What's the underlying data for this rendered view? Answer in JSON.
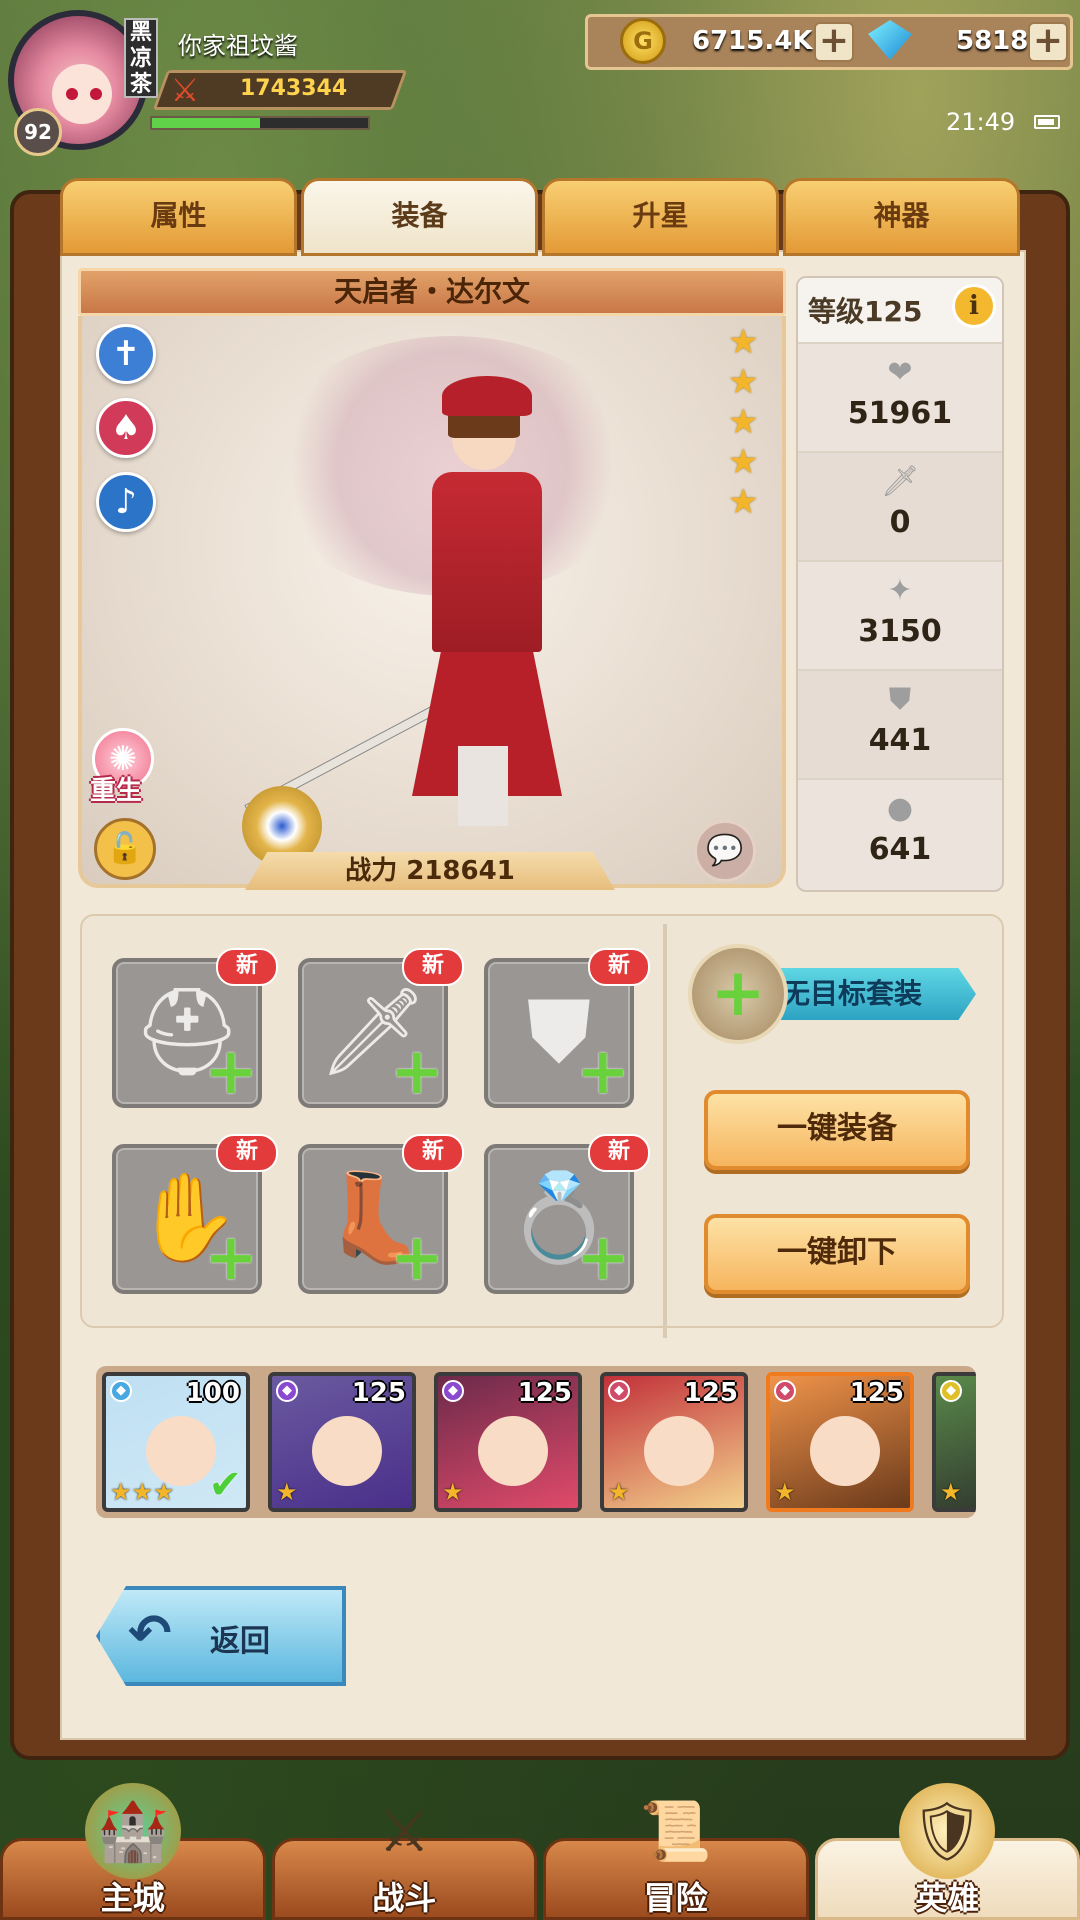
{
  "player": {
    "name": "你家祖坟酱",
    "level": "92",
    "guild_tag": "黑凉茶",
    "combat_power": "1743344",
    "exp_fraction": 0.5
  },
  "resources": {
    "gold": "6715.4K",
    "gems": "5818"
  },
  "status": {
    "time": "21:49"
  },
  "tabs": [
    "属性",
    "装备",
    "升星",
    "神器"
  ],
  "active_tab": "装备",
  "hero": {
    "name": "天启者・达尔文",
    "stars": 5,
    "combat_power_label": "战力 218641",
    "rebirth_label": "重生"
  },
  "stats": {
    "level_label": "等级125",
    "hp": "51961",
    "attack": "0",
    "magic": "3150",
    "defense": "441",
    "magic_defense": "641"
  },
  "equipment": {
    "new_badge": "新",
    "slots": [
      "helmet",
      "weapon",
      "armor",
      "gloves",
      "boots",
      "ring"
    ],
    "suit_label": "无目标套装",
    "equip_all": "一键装备",
    "unequip_all": "一键卸下"
  },
  "hero_list": [
    {
      "level": "100",
      "stars": "★★★",
      "class_color": "#4aa8e0",
      "bg": "#bfe0f3",
      "hair": "#cfe8f5",
      "selected": false,
      "equipped": true
    },
    {
      "level": "125",
      "stars": "★",
      "class_color": "#8a4ad0",
      "bg": "#6a5aa0",
      "hair": "#4a2f8a",
      "selected": false,
      "equipped": false
    },
    {
      "level": "125",
      "stars": "★",
      "class_color": "#8a4ad0",
      "bg": "#6c2a4a",
      "hair": "#e04a6a",
      "selected": false,
      "equipped": false
    },
    {
      "level": "125",
      "stars": "★",
      "class_color": "#d04a6a",
      "bg": "#c2303a",
      "hair": "#f3d18c",
      "selected": false,
      "equipped": false
    },
    {
      "level": "125",
      "stars": "★",
      "class_color": "#d04a6a",
      "bg": "#f0934a",
      "hair": "#6a3a1b",
      "selected": true,
      "equipped": false
    },
    {
      "level": "",
      "stars": "★",
      "class_color": "#e0c02a",
      "bg": "#5a8a4a",
      "hair": "#2a2a2a",
      "selected": false,
      "equipped": false
    }
  ],
  "back_label": "返回",
  "nav": [
    {
      "label": "主城",
      "icon": "castle-icon"
    },
    {
      "label": "战斗",
      "icon": "crossed-swords-icon"
    },
    {
      "label": "冒险",
      "icon": "map-scroll-icon"
    },
    {
      "label": "英雄",
      "icon": "hero-crest-icon"
    }
  ],
  "active_nav": "英雄"
}
